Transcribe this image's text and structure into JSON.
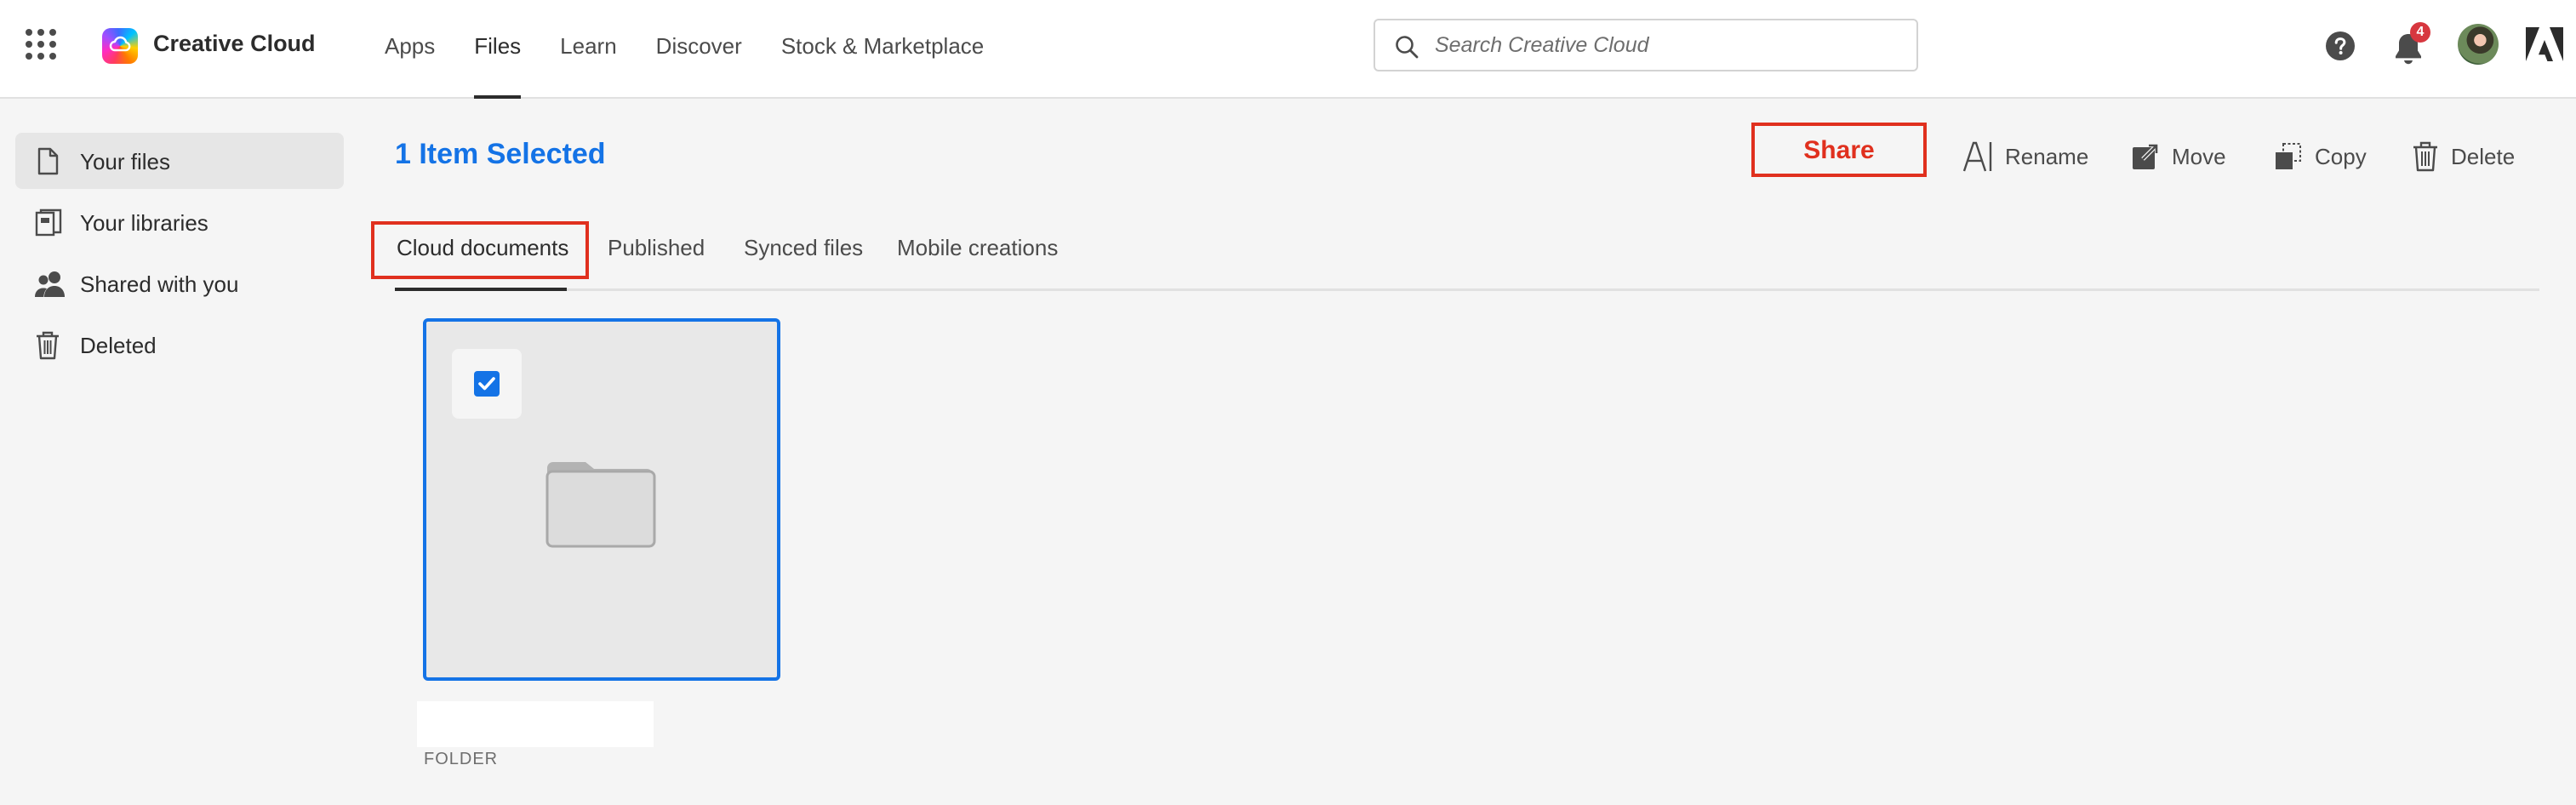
{
  "header": {
    "brand": "Creative Cloud",
    "nav": [
      "Apps",
      "Files",
      "Learn",
      "Discover",
      "Stock & Marketplace"
    ],
    "active_nav": "Files",
    "search_placeholder": "Search Creative Cloud",
    "notification_count": "4"
  },
  "sidebar": {
    "items": [
      {
        "label": "Your files",
        "icon": "file-icon",
        "active": true
      },
      {
        "label": "Your libraries",
        "icon": "libraries-icon"
      },
      {
        "label": "Shared with you",
        "icon": "people-icon"
      },
      {
        "label": "Deleted",
        "icon": "trash-icon"
      }
    ]
  },
  "main": {
    "selection_title": "1 Item Selected",
    "actions": {
      "share": "Share",
      "rename": "Rename",
      "move": "Move",
      "copy": "Copy",
      "delete": "Delete"
    },
    "tabs": [
      "Cloud documents",
      "Published",
      "Synced files",
      "Mobile creations"
    ],
    "active_tab": "Cloud documents",
    "items": [
      {
        "name": "",
        "type_label": "FOLDER",
        "selected": true
      }
    ]
  },
  "colors": {
    "accent": "#1473e6",
    "highlight": "#e0301e",
    "badge": "#d7373f"
  }
}
